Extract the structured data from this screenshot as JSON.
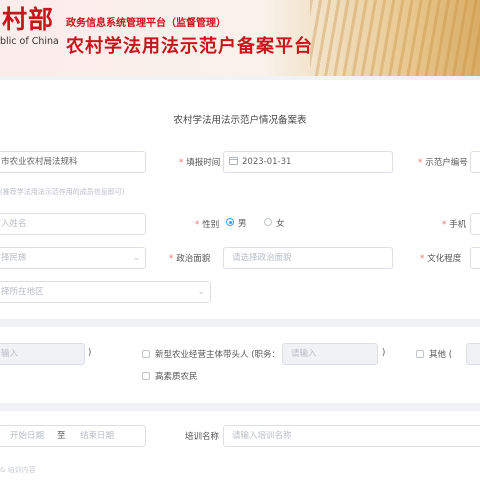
{
  "banner": {
    "brand_cn": "村部",
    "brand_en": "blic of China",
    "top_line": "政务信息系统管理平台（监督管理）",
    "main_title": "农村学法用法示范户备案平台"
  },
  "form": {
    "title": "农村学法用法示范户情况备案表",
    "org_value": "市农业农村局法规科",
    "fill_time_label": "填报时间",
    "fill_time_value": "2023-01-31",
    "household_no_label": "示范户编号",
    "hint": "(推荐学法用法示范作用的成员信息即可)",
    "name_placeholder": "入姓名",
    "gender_label": "性别",
    "gender_male": "男",
    "gender_female": "女",
    "phone_label": "手机",
    "ethnicity_placeholder": "择民族",
    "politics_label": "政治面貌",
    "politics_placeholder": "请选择政治面貌",
    "education_label": "文化程度",
    "region_placeholder": "择所在地区"
  },
  "identity": {
    "first_placeholder": "输入",
    "paren_close": ")",
    "new_agri_label": "新型农业经营主体带头人 (职务：",
    "new_agri_placeholder": "请输入",
    "other_label": "其他 (",
    "high_quality_label": "高素质农民"
  },
  "training": {
    "start_placeholder": "开始日期",
    "to": "至",
    "end_placeholder": "结束日期",
    "name_label": "培训名称",
    "name_placeholder": "请输入培训名称",
    "bottom_hint": "& 培训内容"
  },
  "colors": {
    "brand_red": "#c8161d",
    "accent_blue": "#409eff"
  }
}
